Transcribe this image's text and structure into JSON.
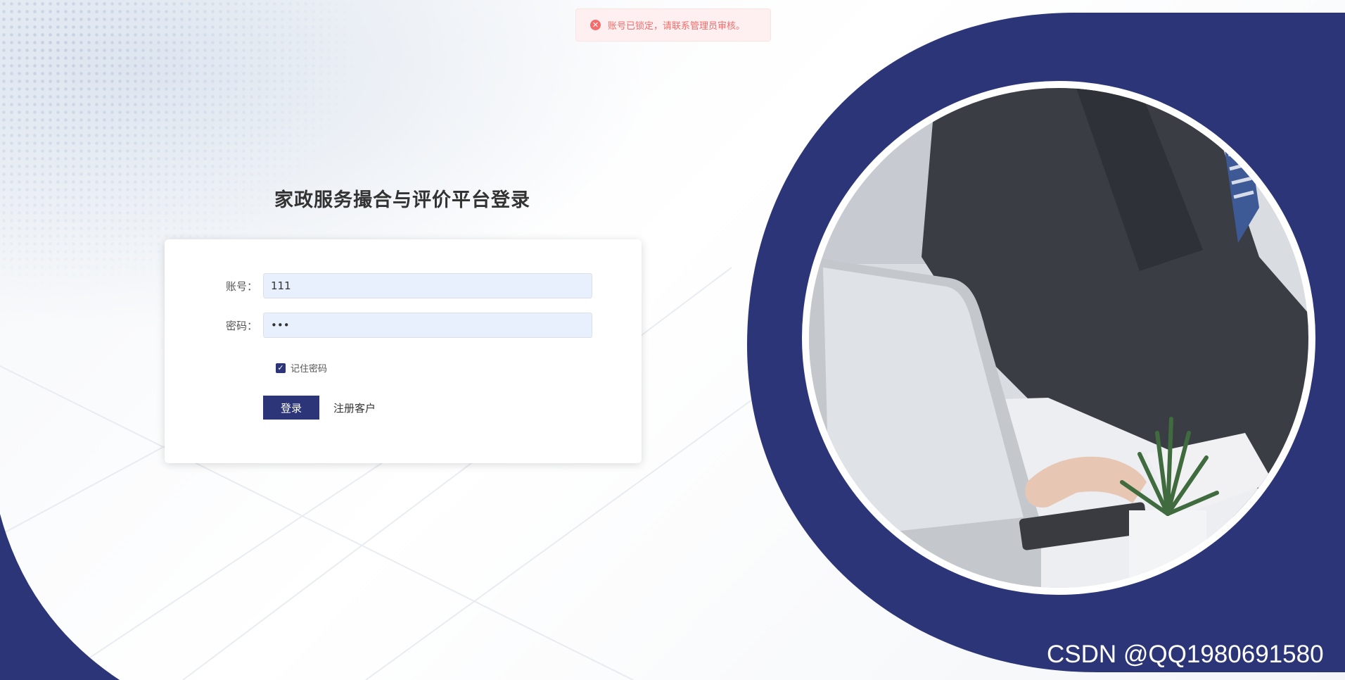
{
  "toast": {
    "message": "账号已锁定，请联系管理员审核。",
    "icon": "error-circle-icon",
    "color": "#f56c6c"
  },
  "login": {
    "title": "家政服务撮合与评价平台登录",
    "account_label": "账号：",
    "account_value": "111",
    "password_label": "密码：",
    "password_value": "•••",
    "remember_label": "记住密码",
    "remember_checked": true,
    "login_button": "登录",
    "register_link": "注册客户"
  },
  "watermark": "CSDN @QQ1980691580",
  "colors": {
    "brand": "#2b3578",
    "input_bg": "#e8f0fe"
  }
}
